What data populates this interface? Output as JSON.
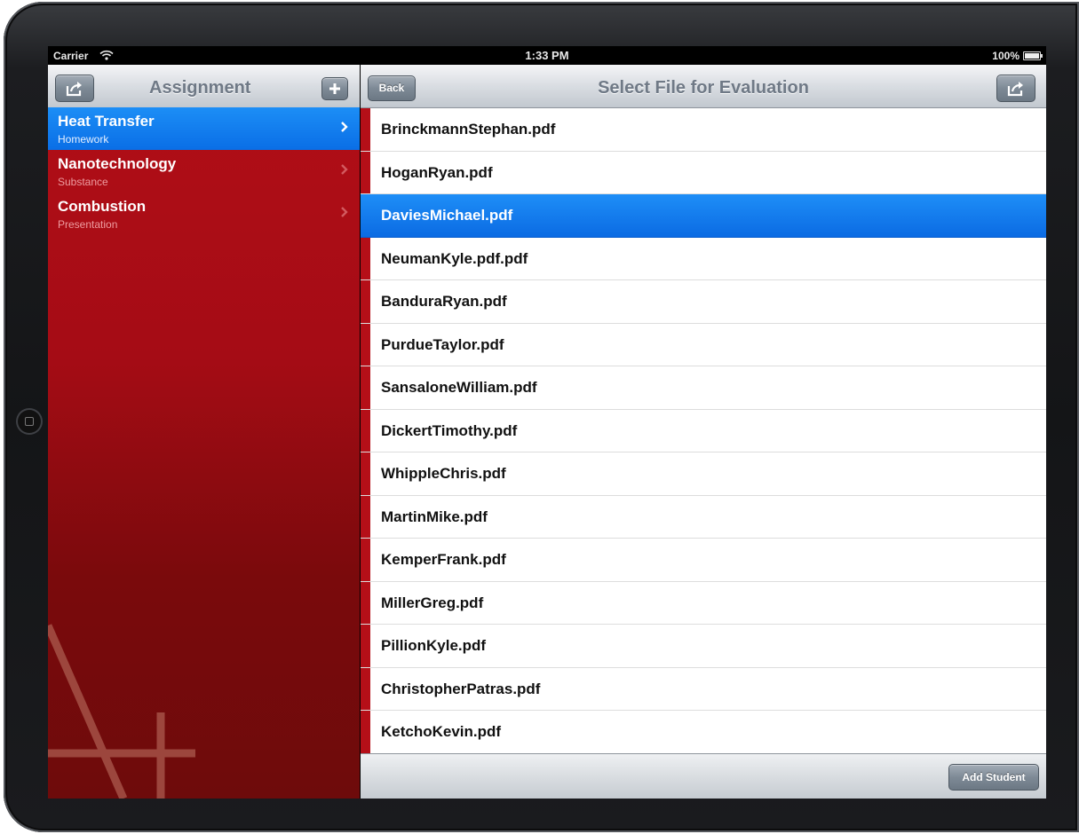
{
  "status_bar": {
    "carrier": "Carrier",
    "time": "1:33 PM",
    "battery": "100%"
  },
  "master": {
    "title": "Assignment",
    "items": [
      {
        "title": "Heat Transfer",
        "subtitle": "Homework",
        "selected": true
      },
      {
        "title": "Nanotechnology",
        "subtitle": "Substance",
        "selected": false
      },
      {
        "title": "Combustion",
        "subtitle": "Presentation",
        "selected": false
      }
    ]
  },
  "detail": {
    "title": "Select File for Evaluation",
    "back_label": "Back",
    "files": [
      "BrinckmannStephan.pdf",
      "HoganRyan.pdf",
      "DaviesMichael.pdf",
      "NeumanKyle.pdf.pdf",
      "BanduraRyan.pdf",
      "PurdueTaylor.pdf",
      "SansaloneWilliam.pdf",
      "DickertTimothy.pdf",
      "WhippleChris.pdf",
      "MartinMike.pdf",
      "KemperFrank.pdf",
      "MillerGreg.pdf",
      "PillionKyle.pdf",
      "ChristopherPatras.pdf",
      "KetchoKevin.pdf"
    ],
    "selected_file": "DaviesMichael.pdf",
    "add_button_label": "Add Student"
  },
  "icons": {
    "share": "share-icon",
    "add": "plus-icon",
    "disclosure": "chevron-right-icon",
    "wifi": "wifi-icon",
    "battery": "battery-icon"
  },
  "colors": {
    "selection_blue": "#0a6ee6",
    "master_red": "#b20e17",
    "row_stripe": "#b50f18"
  }
}
